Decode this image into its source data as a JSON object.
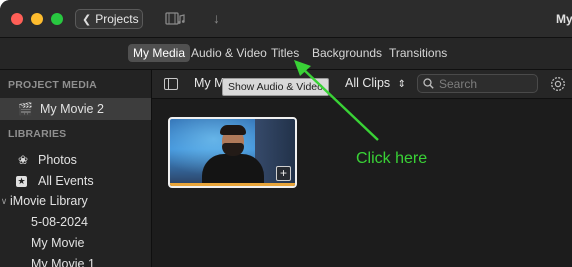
{
  "titlebar": {
    "projects_label": "Projects",
    "window_title": "My"
  },
  "tabs": [
    {
      "label": "My Media",
      "active": true
    },
    {
      "label": "Audio & Video",
      "active": false
    },
    {
      "label": "Titles",
      "active": false
    },
    {
      "label": "Backgrounds",
      "active": false
    },
    {
      "label": "Transitions",
      "active": false
    }
  ],
  "sidebar": {
    "project_header": "PROJECT MEDIA",
    "project_item": "My Movie 2",
    "libraries_header": "LIBRARIES",
    "items": [
      {
        "label": "Photos",
        "icon": "photos-icon"
      },
      {
        "label": "All Events",
        "icon": "star-icon"
      },
      {
        "label": "iMovie Library",
        "icon": "chevron-down-icon"
      },
      {
        "label": "5-08-2024"
      },
      {
        "label": "My Movie"
      },
      {
        "label": "My Movie 1"
      }
    ]
  },
  "main": {
    "library_name": "My M",
    "tooltip": "Show Audio & Video",
    "filter_label": "All Clips",
    "search_placeholder": "Search"
  },
  "annotation": {
    "text": "Click here",
    "color": "#39d236"
  },
  "colors": {
    "red": "#ff5f57",
    "yellow": "#febc2e",
    "green": "#28c840",
    "selection": "#3d3d3d"
  }
}
